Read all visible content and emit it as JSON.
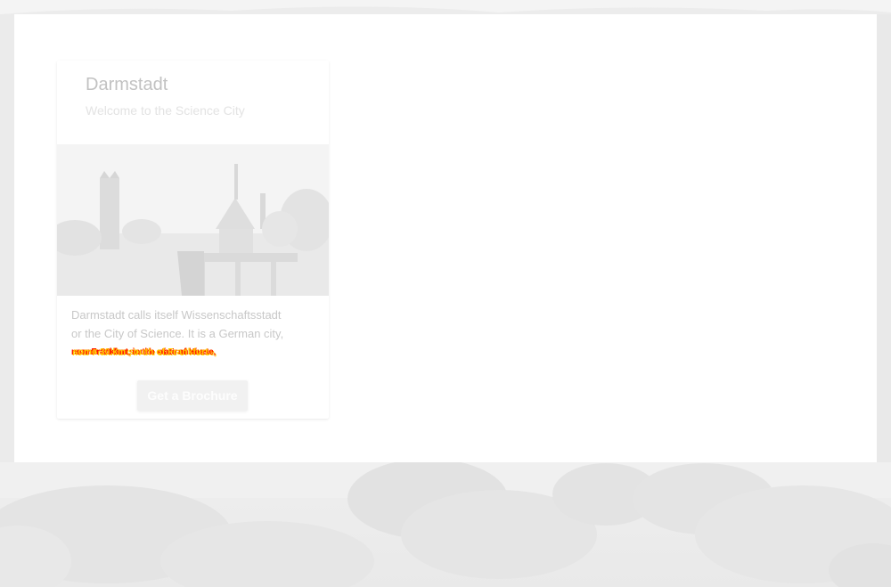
{
  "card": {
    "title": "Darmstadt",
    "subtitle": "Welcome to the Science City",
    "image_icon": "darmstadt-landmark-image",
    "text_line_1": "Darmstadt calls itself Wissenschaftsstadt",
    "text_line_2": "or the City of Science. It is a German city,",
    "text_line_3a": "near Frankfurt, in the state of Hesse,",
    "text_line_3b": "some 30 km south of Frankfurt.",
    "button_label": "Get a Brochure"
  },
  "colors": {
    "overlap_red": "#ff1a00",
    "overlap_yellow": "#ffcc00"
  }
}
